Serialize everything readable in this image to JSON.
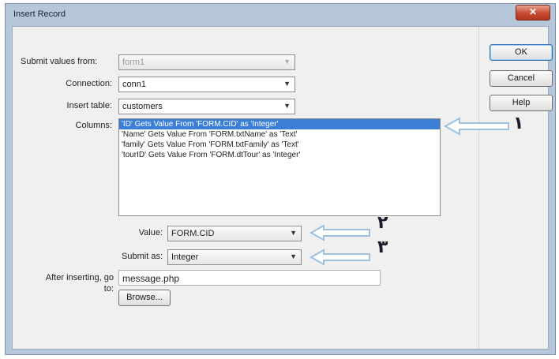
{
  "window": {
    "title": "Insert Record",
    "close_glyph": "✕"
  },
  "form": {
    "submit_values_from": {
      "label": "Submit values from:",
      "value": "form1"
    },
    "connection": {
      "label": "Connection:",
      "value": "conn1"
    },
    "insert_table": {
      "label": "Insert table:",
      "value": "customers"
    },
    "columns": {
      "label": "Columns:",
      "items": [
        "'ID' Gets Value From 'FORM.CID' as 'Integer'",
        "'Name' Gets Value From 'FORM.txtName' as 'Text'",
        "'family' Gets Value From 'FORM.txtFamily' as 'Text'",
        "'tourID' Gets Value From 'FORM.dtTour' as 'Integer'"
      ],
      "selected_index": 0
    },
    "value": {
      "label": "Value:",
      "value": "FORM.CID"
    },
    "submit_as": {
      "label": "Submit as:",
      "value": "Integer"
    },
    "after_inserting": {
      "label_line1": "After inserting, go",
      "label_line2": "to:",
      "value": "message.php"
    },
    "browse_label": "Browse..."
  },
  "buttons": {
    "ok": "OK",
    "cancel": "Cancel",
    "help": "Help"
  },
  "annotations": [
    "١",
    "٢",
    "٣"
  ],
  "icons": {
    "dropdown": "chevron-down-icon",
    "pointer": "outline-left-arrow"
  }
}
